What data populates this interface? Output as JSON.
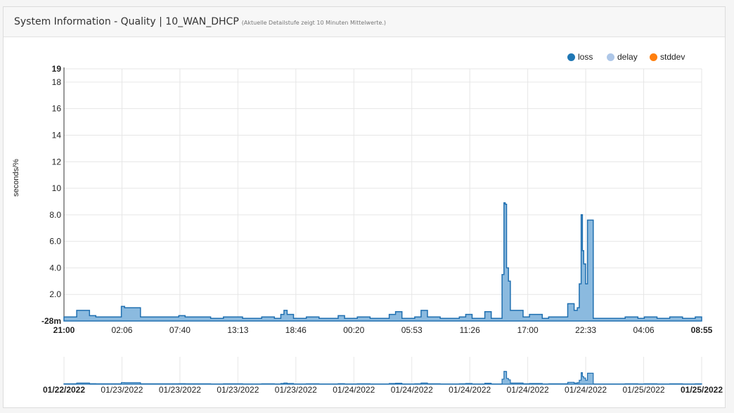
{
  "panel": {
    "title": "System Information - Quality | 10_WAN_DHCP",
    "subtitle": "(Aktuelle Detailstufe zeigt 10 Minuten Mittelwerte.)"
  },
  "chart_data": [
    {
      "type": "area",
      "ylabel": "seconds/%",
      "ylim": [
        -28,
        19
      ],
      "ytick_labels": [
        "19",
        "18",
        "16",
        "14",
        "12",
        "10",
        "8.0",
        "6.0",
        "4.0",
        "2.0",
        "-28m"
      ],
      "ytick_values": [
        19,
        18,
        16,
        14,
        12,
        10,
        8,
        6,
        4,
        2,
        0
      ],
      "xtick_labels": [
        "21:00",
        "02:06",
        "07:40",
        "13:13",
        "18:46",
        "00:20",
        "05:53",
        "11:26",
        "17:00",
        "22:33",
        "04:06",
        "08:55"
      ],
      "legend": [
        {
          "name": "loss",
          "color": "#1f77b4"
        },
        {
          "name": "delay",
          "color": "#aec7e8"
        },
        {
          "name": "stddev",
          "color": "#ff7f0e"
        }
      ],
      "legend_position": "top-right",
      "grid": true,
      "series": [
        {
          "name": "loss",
          "color": "#1f77b4",
          "x_range": [
            "21:00",
            "08:55"
          ],
          "points": [
            [
              0.0,
              0.3
            ],
            [
              0.01,
              0.3
            ],
            [
              0.02,
              0.8
            ],
            [
              0.04,
              0.4
            ],
            [
              0.05,
              0.3
            ],
            [
              0.07,
              0.3
            ],
            [
              0.09,
              1.1
            ],
            [
              0.095,
              1.0
            ],
            [
              0.12,
              0.3
            ],
            [
              0.18,
              0.4
            ],
            [
              0.19,
              0.3
            ],
            [
              0.23,
              0.2
            ],
            [
              0.25,
              0.3
            ],
            [
              0.28,
              0.2
            ],
            [
              0.31,
              0.3
            ],
            [
              0.32,
              0.3
            ],
            [
              0.33,
              0.2
            ],
            [
              0.34,
              0.5
            ],
            [
              0.345,
              0.8
            ],
            [
              0.35,
              0.5
            ],
            [
              0.36,
              0.2
            ],
            [
              0.38,
              0.3
            ],
            [
              0.4,
              0.2
            ],
            [
              0.43,
              0.4
            ],
            [
              0.44,
              0.2
            ],
            [
              0.46,
              0.3
            ],
            [
              0.48,
              0.2
            ],
            [
              0.5,
              0.2
            ],
            [
              0.51,
              0.5
            ],
            [
              0.52,
              0.7
            ],
            [
              0.53,
              0.2
            ],
            [
              0.55,
              0.3
            ],
            [
              0.56,
              0.8
            ],
            [
              0.57,
              0.3
            ],
            [
              0.59,
              0.2
            ],
            [
              0.62,
              0.3
            ],
            [
              0.63,
              0.5
            ],
            [
              0.64,
              0.2
            ],
            [
              0.66,
              0.7
            ],
            [
              0.67,
              0.2
            ],
            [
              0.687,
              3.5
            ],
            [
              0.69,
              8.9
            ],
            [
              0.692,
              8.8
            ],
            [
              0.694,
              4.0
            ],
            [
              0.697,
              3.0
            ],
            [
              0.7,
              0.8
            ],
            [
              0.72,
              0.3
            ],
            [
              0.73,
              0.5
            ],
            [
              0.75,
              0.2
            ],
            [
              0.76,
              0.3
            ],
            [
              0.78,
              0.3
            ],
            [
              0.79,
              1.3
            ],
            [
              0.8,
              0.8
            ],
            [
              0.805,
              1.0
            ],
            [
              0.808,
              2.8
            ],
            [
              0.811,
              8.0
            ],
            [
              0.813,
              5.3
            ],
            [
              0.815,
              4.3
            ],
            [
              0.818,
              2.8
            ],
            [
              0.821,
              7.6
            ],
            [
              0.83,
              0.2
            ],
            [
              0.85,
              0.2
            ],
            [
              0.88,
              0.3
            ],
            [
              0.9,
              0.2
            ],
            [
              0.91,
              0.3
            ],
            [
              0.93,
              0.2
            ],
            [
              0.95,
              0.3
            ],
            [
              0.97,
              0.2
            ],
            [
              0.98,
              0.2
            ],
            [
              0.99,
              0.3
            ],
            [
              1.0,
              0.2
            ]
          ]
        }
      ]
    },
    {
      "type": "area",
      "role": "navigator",
      "xtick_labels": [
        "01/22/2022",
        "01/23/2022",
        "01/23/2022",
        "01/23/2022",
        "01/23/2022",
        "01/24/2022",
        "01/24/2022",
        "01/24/2022",
        "01/24/2022",
        "01/24/2022",
        "01/25/2022",
        "01/25/2022"
      ]
    }
  ]
}
